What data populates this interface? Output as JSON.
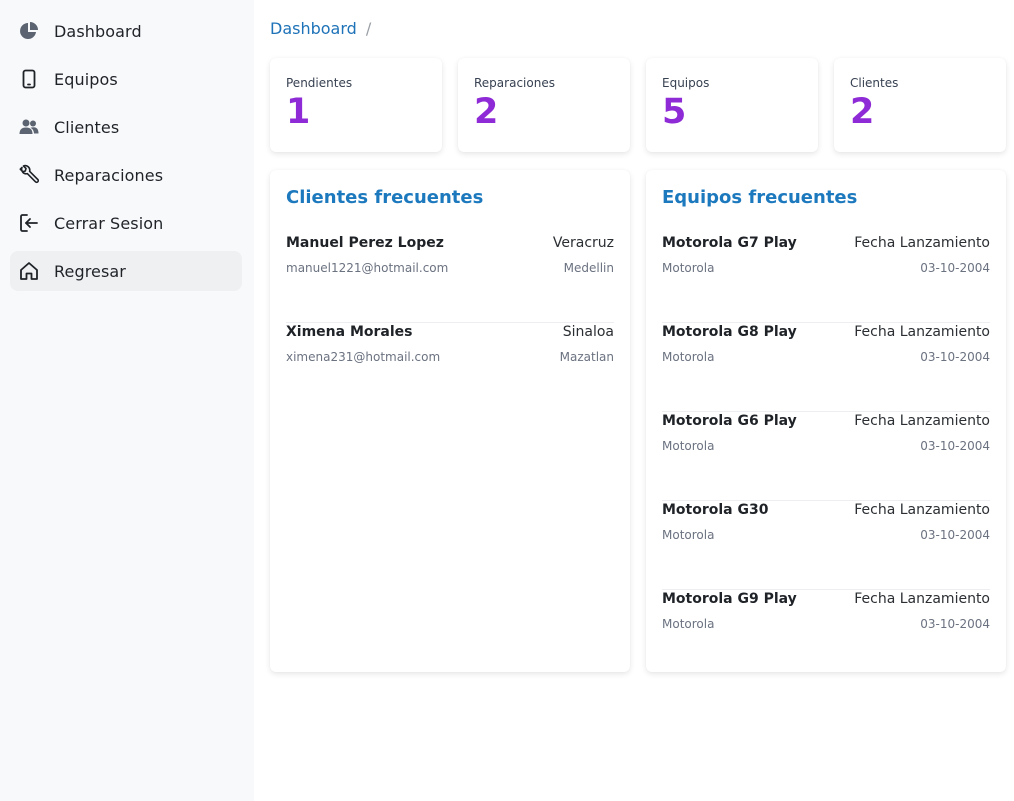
{
  "sidebar": {
    "items": [
      {
        "label": "Dashboard",
        "icon": "pie-chart-icon"
      },
      {
        "label": "Equipos",
        "icon": "phone-icon"
      },
      {
        "label": "Clientes",
        "icon": "users-icon"
      },
      {
        "label": "Reparaciones",
        "icon": "wrench-icon"
      },
      {
        "label": "Cerrar Sesion",
        "icon": "logout-icon"
      },
      {
        "label": "Regresar",
        "icon": "home-icon"
      }
    ]
  },
  "breadcrumb": {
    "current": "Dashboard",
    "separator": "/"
  },
  "stats": [
    {
      "label": "Pendientes",
      "value": "1"
    },
    {
      "label": "Reparaciones",
      "value": "2"
    },
    {
      "label": "Equipos",
      "value": "5"
    },
    {
      "label": "Clientes",
      "value": "2"
    }
  ],
  "clientes": {
    "title": "Clientes frecuentes",
    "rows": [
      {
        "name": "Manuel Perez Lopez",
        "email": "manuel1221@hotmail.com",
        "state": "Veracruz",
        "city": "Medellin"
      },
      {
        "name": "Ximena Morales",
        "email": "ximena231@hotmail.com",
        "state": "Sinaloa",
        "city": "Mazatlan"
      }
    ]
  },
  "equipos": {
    "title": "Equipos frecuentes",
    "rows": [
      {
        "name": "Motorola G7 Play",
        "brand": "Motorola",
        "date_label": "Fecha Lanzamiento",
        "date": "03-10-2004"
      },
      {
        "name": "Motorola G8 Play",
        "brand": "Motorola",
        "date_label": "Fecha Lanzamiento",
        "date": "03-10-2004"
      },
      {
        "name": "Motorola G6 Play",
        "brand": "Motorola",
        "date_label": "Fecha Lanzamiento",
        "date": "03-10-2004"
      },
      {
        "name": "Motorola G30",
        "brand": "Motorola",
        "date_label": "Fecha Lanzamiento",
        "date": "03-10-2004"
      },
      {
        "name": "Motorola G9 Play",
        "brand": "Motorola",
        "date_label": "Fecha Lanzamiento",
        "date": "03-10-2004"
      }
    ]
  },
  "colors": {
    "accent_blue": "#1d79be",
    "stat_purple": "#8e2bd6",
    "sidebar_bg": "#f8f9fb"
  }
}
